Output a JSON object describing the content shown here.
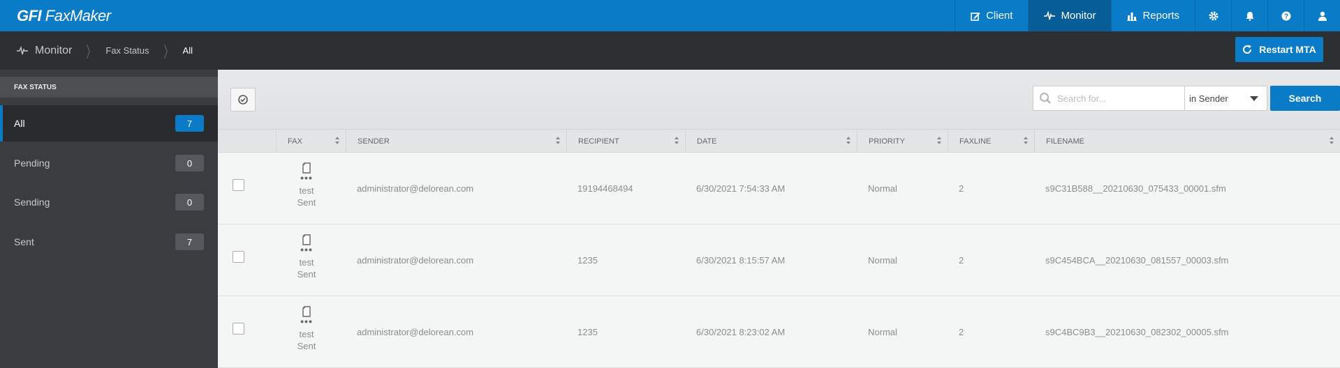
{
  "app": {
    "logo_bold": "GFI",
    "logo_rest": "FaxMaker"
  },
  "topnav": {
    "client": "Client",
    "monitor": "Monitor",
    "reports": "Reports",
    "icons": [
      "gear-icon",
      "bell-icon",
      "help-icon",
      "user-icon"
    ]
  },
  "breadcrumb": {
    "root": "Monitor",
    "level1": "Fax Status",
    "current": "All"
  },
  "restart_button": "Restart MTA",
  "sidebar": {
    "heading": "FAX STATUS",
    "items": [
      {
        "label": "All",
        "count": "7"
      },
      {
        "label": "Pending",
        "count": "0"
      },
      {
        "label": "Sending",
        "count": "0"
      },
      {
        "label": "Sent",
        "count": "7"
      }
    ]
  },
  "search": {
    "placeholder": "Search for...",
    "scope": "in Sender",
    "button": "Search"
  },
  "table": {
    "columns": [
      "FAX",
      "SENDER",
      "RECIPIENT",
      "DATE",
      "PRIORITY",
      "FAXLINE",
      "FILENAME"
    ],
    "rows": [
      {
        "fax_name": "test",
        "fax_status": "Sent",
        "sender": "administrator@delorean.com",
        "recipient": "19194468494",
        "date": "6/30/2021 7:54:33 AM",
        "priority": "Normal",
        "faxline": "2",
        "filename": "s9C31B588__20210630_075433_00001.sfm"
      },
      {
        "fax_name": "test",
        "fax_status": "Sent",
        "sender": "administrator@delorean.com",
        "recipient": "1235",
        "date": "6/30/2021 8:15:57 AM",
        "priority": "Normal",
        "faxline": "2",
        "filename": "s9C454BCA__20210630_081557_00003.sfm"
      },
      {
        "fax_name": "test",
        "fax_status": "Sent",
        "sender": "administrator@delorean.com",
        "recipient": "1235",
        "date": "6/30/2021 8:23:02 AM",
        "priority": "Normal",
        "faxline": "2",
        "filename": "s9C4BC9B3__20210630_082302_00005.sfm"
      }
    ]
  },
  "colors": {
    "brand_blue": "#0a7bc6",
    "active_nav": "#065d97",
    "dark_bar": "#2d2f32",
    "sidebar_bg": "#3a3c3f"
  }
}
